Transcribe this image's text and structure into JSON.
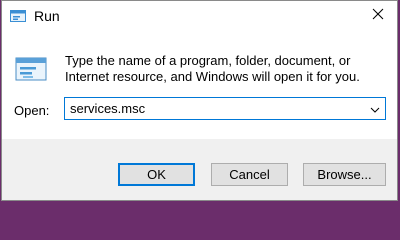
{
  "window": {
    "title": "Run",
    "close_symbol": "×"
  },
  "content": {
    "description": "Type the name of a program, folder, document, or Internet resource, and Windows will open it for you.",
    "open_label": "Open:",
    "input_value": "services.msc"
  },
  "buttons": {
    "ok": "OK",
    "cancel": "Cancel",
    "browse": "Browse..."
  },
  "colors": {
    "accent": "#0078d7",
    "footer_bg": "#f0f0f0",
    "button_bg": "#e1e1e1",
    "desktop_bg": "#6b2d6b"
  },
  "icons": {
    "title": "run-app-icon",
    "large": "run-program-icon",
    "close": "close-icon",
    "dropdown": "chevron-down-icon"
  }
}
